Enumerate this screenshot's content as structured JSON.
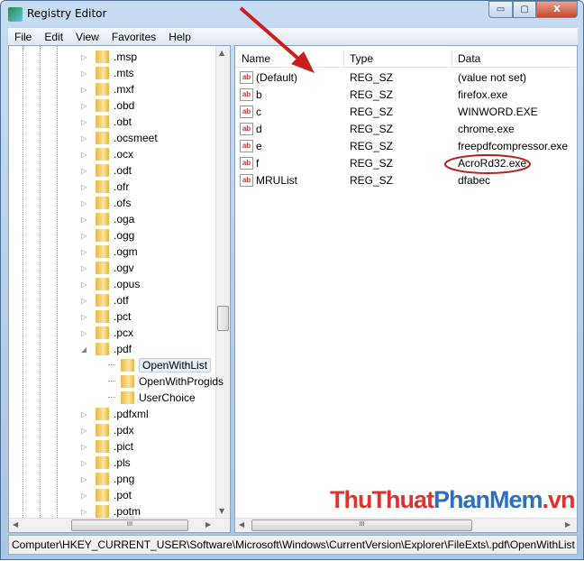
{
  "window": {
    "title": "Registry Editor",
    "minimize": "▭",
    "maximize": "▢",
    "close": "X"
  },
  "menu": [
    "File",
    "Edit",
    "View",
    "Favorites",
    "Help"
  ],
  "tree": [
    {
      "label": ".msp",
      "expander": "▷",
      "level": 0
    },
    {
      "label": ".mts",
      "expander": "▷",
      "level": 0
    },
    {
      "label": ".mxf",
      "expander": "▷",
      "level": 0
    },
    {
      "label": ".obd",
      "expander": "▷",
      "level": 0
    },
    {
      "label": ".obt",
      "expander": "▷",
      "level": 0
    },
    {
      "label": ".ocsmeet",
      "expander": "▷",
      "level": 0
    },
    {
      "label": ".ocx",
      "expander": "▷",
      "level": 0
    },
    {
      "label": ".odt",
      "expander": "▷",
      "level": 0
    },
    {
      "label": ".ofr",
      "expander": "▷",
      "level": 0
    },
    {
      "label": ".ofs",
      "expander": "▷",
      "level": 0
    },
    {
      "label": ".oga",
      "expander": "▷",
      "level": 0
    },
    {
      "label": ".ogg",
      "expander": "▷",
      "level": 0
    },
    {
      "label": ".ogm",
      "expander": "▷",
      "level": 0
    },
    {
      "label": ".ogv",
      "expander": "▷",
      "level": 0
    },
    {
      "label": ".opus",
      "expander": "▷",
      "level": 0
    },
    {
      "label": ".otf",
      "expander": "▷",
      "level": 0
    },
    {
      "label": ".pct",
      "expander": "▷",
      "level": 0
    },
    {
      "label": ".pcx",
      "expander": "▷",
      "level": 0
    },
    {
      "label": ".pdf",
      "expander": "◢",
      "level": 0
    },
    {
      "label": "OpenWithList",
      "expander": "",
      "level": 1,
      "selected": true
    },
    {
      "label": "OpenWithProgids",
      "expander": "",
      "level": 1
    },
    {
      "label": "UserChoice",
      "expander": "",
      "level": 1
    },
    {
      "label": ".pdfxml",
      "expander": "▷",
      "level": 0
    },
    {
      "label": ".pdx",
      "expander": "▷",
      "level": 0
    },
    {
      "label": ".pict",
      "expander": "▷",
      "level": 0
    },
    {
      "label": ".pls",
      "expander": "▷",
      "level": 0
    },
    {
      "label": ".png",
      "expander": "▷",
      "level": 0
    },
    {
      "label": ".pot",
      "expander": "▷",
      "level": 0
    },
    {
      "label": ".potm",
      "expander": "▷",
      "level": 0
    }
  ],
  "columns": {
    "name": "Name",
    "type": "Type",
    "data": "Data"
  },
  "values": [
    {
      "icon": "ab",
      "name": "(Default)",
      "type": "REG_SZ",
      "data": "(value not set)"
    },
    {
      "icon": "ab",
      "name": "b",
      "type": "REG_SZ",
      "data": "firefox.exe"
    },
    {
      "icon": "ab",
      "name": "c",
      "type": "REG_SZ",
      "data": "WINWORD.EXE"
    },
    {
      "icon": "ab",
      "name": "d",
      "type": "REG_SZ",
      "data": "chrome.exe"
    },
    {
      "icon": "ab",
      "name": "e",
      "type": "REG_SZ",
      "data": "freepdfcompressor.exe"
    },
    {
      "icon": "ab",
      "name": "f",
      "type": "REG_SZ",
      "data": "AcroRd32.exe"
    },
    {
      "icon": "ab",
      "name": "MRUList",
      "type": "REG_SZ",
      "data": "dfabec"
    }
  ],
  "scroll": {
    "grip": "III",
    "left": "◀",
    "right": "▶",
    "up": "▲",
    "down": "▼"
  },
  "status": "Computer\\HKEY_CURRENT_USER\\Software\\Microsoft\\Windows\\CurrentVersion\\Explorer\\FileExts\\.pdf\\OpenWithList",
  "watermark": {
    "part1": "ThuThuat",
    "part2": "PhanMem",
    "part3": ".vn"
  },
  "colors": {
    "annotation": "#c8201e",
    "selection": "#e7f0fb"
  }
}
